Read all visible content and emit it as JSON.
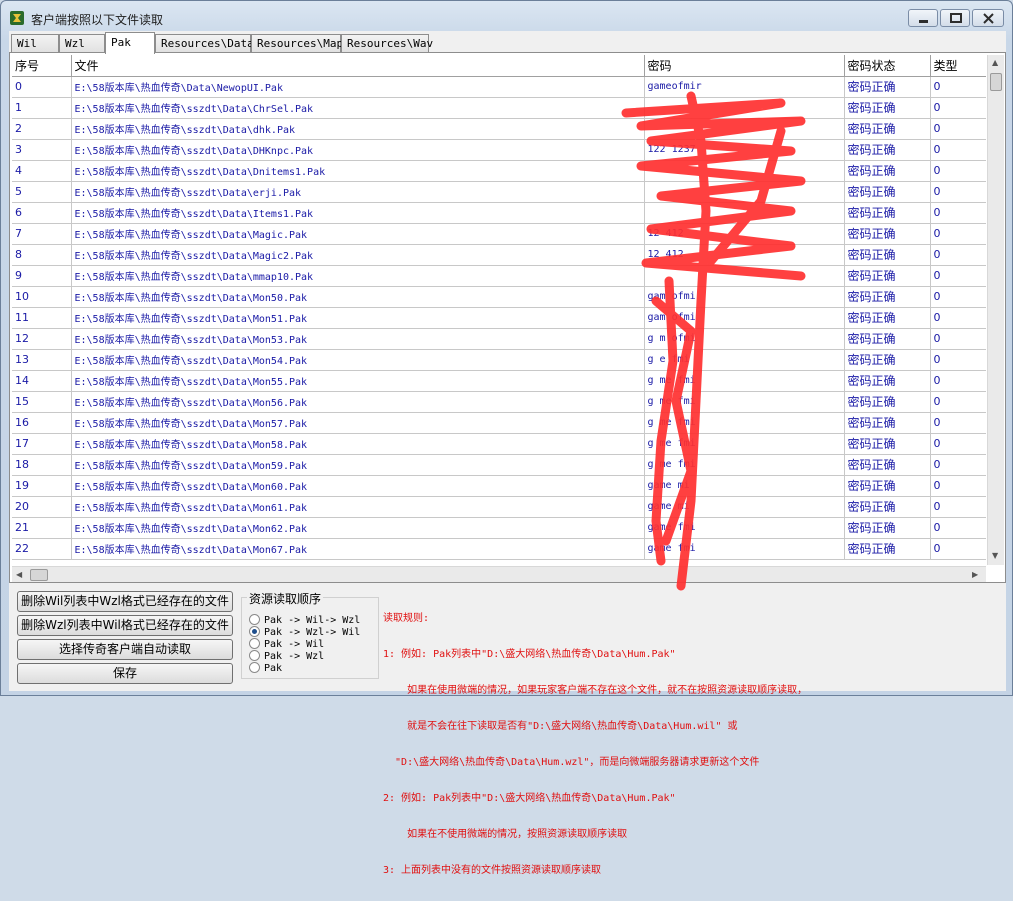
{
  "window": {
    "title": "客户端按照以下文件读取"
  },
  "tabs": [
    "Wil",
    "Wzl",
    "Pak",
    "Resources\\Data",
    "Resources\\Map",
    "Resources\\Wav"
  ],
  "active_tab": "Pak",
  "grid": {
    "headers": [
      "序号",
      "文件",
      "密码",
      "密码状态",
      "类型"
    ],
    "rows": [
      [
        "0",
        "E:\\58版本库\\热血传奇\\Data\\NewopUI.Pak",
        "gameofmir",
        "密码正确",
        "0"
      ],
      [
        "1",
        "E:\\58版本库\\热血传奇\\sszdt\\Data\\ChrSel.Pak",
        "",
        "密码正确",
        "0"
      ],
      [
        "2",
        "E:\\58版本库\\热血传奇\\sszdt\\Data\\dhk.Pak",
        "",
        "密码正确",
        "0"
      ],
      [
        "3",
        "E:\\58版本库\\热血传奇\\sszdt\\Data\\DHKnpc.Pak",
        "122 1237",
        "密码正确",
        "0"
      ],
      [
        "4",
        "E:\\58版本库\\热血传奇\\sszdt\\Data\\Dnitems1.Pak",
        "",
        "密码正确",
        "0"
      ],
      [
        "5",
        "E:\\58版本库\\热血传奇\\sszdt\\Data\\erji.Pak",
        "",
        "密码正确",
        "0"
      ],
      [
        "6",
        "E:\\58版本库\\热血传奇\\sszdt\\Data\\Items1.Pak",
        "",
        "密码正确",
        "0"
      ],
      [
        "7",
        "E:\\58版本库\\热血传奇\\sszdt\\Data\\Magic.Pak",
        "12 412",
        "密码正确",
        "0"
      ],
      [
        "8",
        "E:\\58版本库\\热血传奇\\sszdt\\Data\\Magic2.Pak",
        "12 412",
        "密码正确",
        "0"
      ],
      [
        "9",
        "E:\\58版本库\\热血传奇\\sszdt\\Data\\mmap10.Pak",
        "",
        "密码正确",
        "0"
      ],
      [
        "10",
        "E:\\58版本库\\热血传奇\\sszdt\\Data\\Mon50.Pak",
        "gam ofmi",
        "密码正确",
        "0"
      ],
      [
        "11",
        "E:\\58版本库\\热血传奇\\sszdt\\Data\\Mon51.Pak",
        "gam ofmi",
        "密码正确",
        "0"
      ],
      [
        "12",
        "E:\\58版本库\\热血传奇\\sszdt\\Data\\Mon53.Pak",
        "g m ofmi",
        "密码正确",
        "0"
      ],
      [
        "13",
        "E:\\58版本库\\热血传奇\\sszdt\\Data\\Mon54.Pak",
        "g e fmi",
        "密码正确",
        "0"
      ],
      [
        "14",
        "E:\\58版本库\\热血传奇\\sszdt\\Data\\Mon55.Pak",
        "g me fmi",
        "密码正确",
        "0"
      ],
      [
        "15",
        "E:\\58版本库\\热血传奇\\sszdt\\Data\\Mon56.Pak",
        "g me fmi",
        "密码正确",
        "0"
      ],
      [
        "16",
        "E:\\58版本库\\热血传奇\\sszdt\\Data\\Mon57.Pak",
        "g me fmi",
        "密码正确",
        "0"
      ],
      [
        "17",
        "E:\\58版本库\\热血传奇\\sszdt\\Data\\Mon58.Pak",
        "g me fmi",
        "密码正确",
        "0"
      ],
      [
        "18",
        "E:\\58版本库\\热血传奇\\sszdt\\Data\\Mon59.Pak",
        "g me fmi",
        "密码正确",
        "0"
      ],
      [
        "19",
        "E:\\58版本库\\热血传奇\\sszdt\\Data\\Mon60.Pak",
        "game mi",
        "密码正确",
        "0"
      ],
      [
        "20",
        "E:\\58版本库\\热血传奇\\sszdt\\Data\\Mon61.Pak",
        "game mi",
        "密码正确",
        "0"
      ],
      [
        "21",
        "E:\\58版本库\\热血传奇\\sszdt\\Data\\Mon62.Pak",
        "game fmi",
        "密码正确",
        "0"
      ],
      [
        "22",
        "E:\\58版本库\\热血传奇\\sszdt\\Data\\Mon67.Pak",
        "game fmi",
        "密码正确",
        "0"
      ]
    ]
  },
  "buttons": {
    "del_wil": "删除Wil列表中Wzl格式已经存在的文件",
    "del_wzl": "删除Wzl列表中Wil格式已经存在的文件",
    "auto_read": "选择传奇客户端自动读取",
    "save": "保存"
  },
  "resource_order": {
    "title": "资源读取顺序",
    "options": [
      "Pak -> Wil-> Wzl",
      "Pak -> Wzl-> Wil",
      "Pak -> Wil",
      "Pak -> Wzl",
      "Pak"
    ],
    "selected_index": 1
  },
  "rules": {
    "heading": "读取规则:",
    "lines": [
      "1: 例如: Pak列表中\"D:\\盛大网络\\热血传奇\\Data\\Hum.Pak\"",
      "    如果在使用微端的情况，如果玩家客户端不存在这个文件，就不在按照资源读取顺序读取，",
      "    就是不会在往下读取是否有\"D:\\盛大网络\\热血传奇\\Data\\Hum.wil\" 或",
      "  \"D:\\盛大网络\\热血传奇\\Data\\Hum.wzl\"，而是向微端服务器请求更新这个文件",
      "2: 例如: Pak列表中\"D:\\盛大网络\\热血传奇\\Data\\Hum.Pak\"",
      "    如果在不使用微端的情况，按照资源读取顺序读取",
      "3: 上面列表中没有的文件按照资源读取顺序读取"
    ]
  },
  "colors": {
    "row_text": "#1a1aa6",
    "rules_text": "#e01010",
    "redaction": "#ff3030"
  }
}
